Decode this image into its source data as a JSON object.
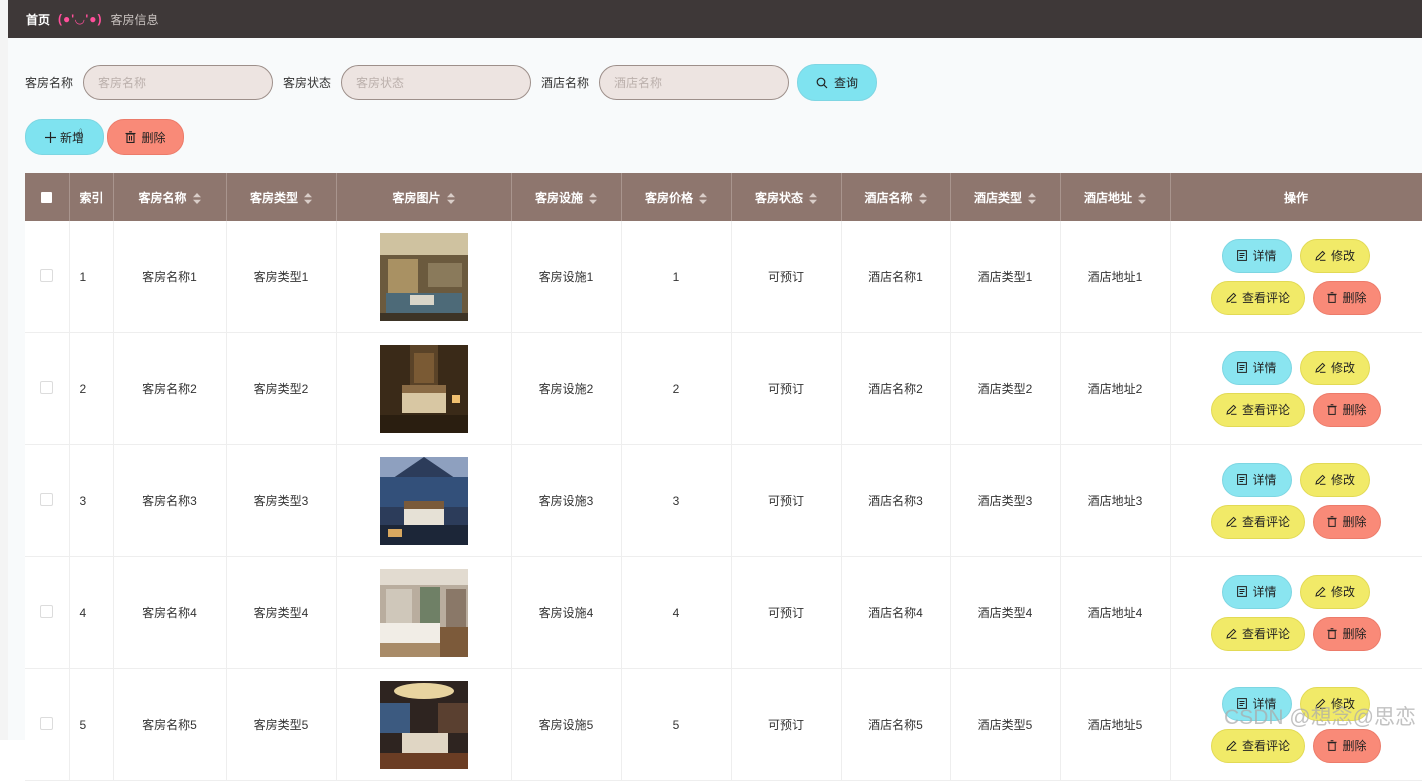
{
  "breadcrumb": {
    "home": "首页",
    "emoji": "(●'◡'●)",
    "current": "客房信息"
  },
  "search": {
    "room_name_label": "客房名称",
    "room_name_placeholder": "客房名称",
    "room_status_label": "客房状态",
    "room_status_placeholder": "客房状态",
    "hotel_name_label": "酒店名称",
    "hotel_name_placeholder": "酒店名称",
    "query_label": "查询"
  },
  "actions": {
    "add_label": "新增",
    "delete_label": "删除"
  },
  "table": {
    "headers": [
      "索引",
      "客房名称",
      "客房类型",
      "客房图片",
      "客房设施",
      "客房价格",
      "客房状态",
      "酒店名称",
      "酒店类型",
      "酒店地址",
      "操作"
    ],
    "rows": [
      {
        "index": "1",
        "room_name": "客房名称1",
        "room_type": "客房类型1",
        "facility": "客房设施1",
        "price": "1",
        "status": "可预订",
        "hotel_name": "酒店名称1",
        "hotel_type": "酒店类型1",
        "hotel_address": "酒店地址1"
      },
      {
        "index": "2",
        "room_name": "客房名称2",
        "room_type": "客房类型2",
        "facility": "客房设施2",
        "price": "2",
        "status": "可预订",
        "hotel_name": "酒店名称2",
        "hotel_type": "酒店类型2",
        "hotel_address": "酒店地址2"
      },
      {
        "index": "3",
        "room_name": "客房名称3",
        "room_type": "客房类型3",
        "facility": "客房设施3",
        "price": "3",
        "status": "可预订",
        "hotel_name": "酒店名称3",
        "hotel_type": "酒店类型3",
        "hotel_address": "酒店地址3"
      },
      {
        "index": "4",
        "room_name": "客房名称4",
        "room_type": "客房类型4",
        "facility": "客房设施4",
        "price": "4",
        "status": "可预订",
        "hotel_name": "酒店名称4",
        "hotel_type": "酒店类型4",
        "hotel_address": "酒店地址4"
      },
      {
        "index": "5",
        "room_name": "客房名称5",
        "room_type": "客房类型5",
        "facility": "客房设施5",
        "price": "5",
        "status": "可预订",
        "hotel_name": "酒店名称5",
        "hotel_type": "酒店类型5",
        "hotel_address": "酒店地址5"
      }
    ],
    "row_ops": {
      "detail": "详情",
      "edit": "修改",
      "review": "查看评论",
      "delete": "删除"
    }
  },
  "watermark": "CSDN @想念@思恋",
  "colors": {
    "topbar": "#3e3838",
    "header": "#8e766e",
    "cyan": "#7fe3f0",
    "yellow": "#f1ea68",
    "salmon": "#f98a78"
  },
  "icons": {
    "query": "search-icon",
    "add": "plus-icon",
    "delete": "trash-icon",
    "detail": "document-icon",
    "edit": "pencil-icon",
    "sort": "sort-caret-icon",
    "cursor": "hand-cursor-icon"
  }
}
